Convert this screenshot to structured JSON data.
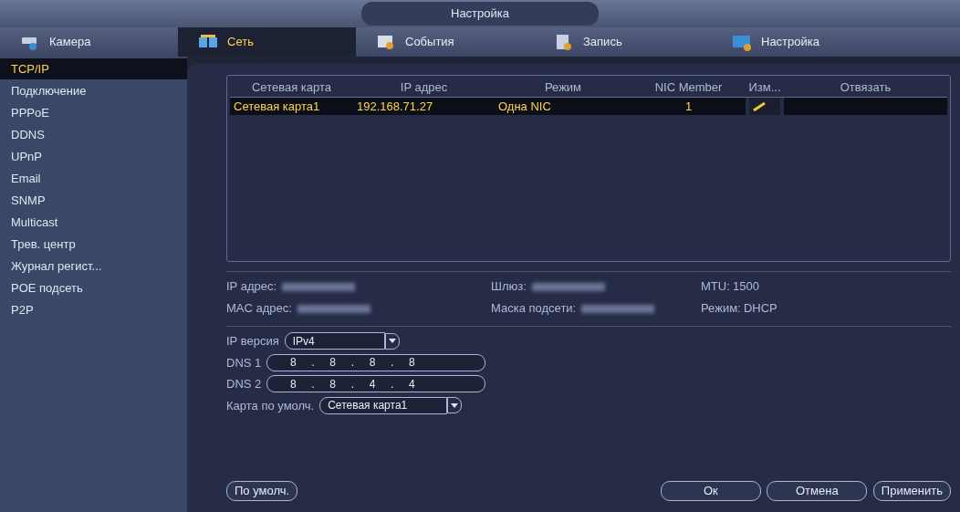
{
  "window": {
    "title": "Настройка"
  },
  "tabs": [
    {
      "label": "Камера",
      "selected": false
    },
    {
      "label": "Сеть",
      "selected": true
    },
    {
      "label": "События",
      "selected": false
    },
    {
      "label": "Запись",
      "selected": false
    },
    {
      "label": "Настройка",
      "selected": false
    }
  ],
  "sidebar": {
    "items": [
      {
        "label": "TCP/IP",
        "selected": true
      },
      {
        "label": "Подключение",
        "selected": false
      },
      {
        "label": "PPPoE",
        "selected": false
      },
      {
        "label": "DDNS",
        "selected": false
      },
      {
        "label": "UPnP",
        "selected": false
      },
      {
        "label": "Email",
        "selected": false
      },
      {
        "label": "SNMP",
        "selected": false
      },
      {
        "label": "Multicast",
        "selected": false
      },
      {
        "label": "Трев. центр",
        "selected": false
      },
      {
        "label": "Журнал регист...",
        "selected": false
      },
      {
        "label": "POE подсеть",
        "selected": false
      },
      {
        "label": "P2P",
        "selected": false
      }
    ]
  },
  "table": {
    "columns": [
      "Сетевая карта",
      "IP адрес",
      "Режим",
      "NIC Member",
      "Изм...",
      "Отвязать"
    ],
    "rows": [
      {
        "selected": true,
        "cells": [
          "Сетевая карта1",
          "192.168.71.27",
          "Одна NIC",
          "1"
        ]
      }
    ]
  },
  "info": {
    "rows": [
      [
        {
          "label": "IP адрес:",
          "kind": "redacted"
        },
        {
          "label": "Шлюз:",
          "kind": "redacted"
        },
        {
          "label": "MTU:",
          "value": "1500",
          "kind": "text"
        }
      ],
      [
        {
          "label": "MAC адрес:",
          "kind": "redacted"
        },
        {
          "label": "Маска подсети:",
          "kind": "redacted"
        },
        {
          "label": "Режим:",
          "value": "DHCP",
          "kind": "text"
        }
      ]
    ]
  },
  "form": {
    "ip_version": {
      "label": "IP версия",
      "value": "IPv4"
    },
    "dns": [
      {
        "label": "DNS 1",
        "octets": [
          "8",
          ".",
          "8",
          ".",
          "8",
          ".",
          "8"
        ]
      },
      {
        "label": "DNS 2",
        "octets": [
          "8",
          ".",
          "8",
          ".",
          "4",
          ".",
          "4"
        ]
      }
    ],
    "default_card": {
      "label": "Карта по умолч.",
      "value": "Сетевая карта1"
    }
  },
  "buttons": {
    "left": [
      "По умолч."
    ],
    "right": [
      "Ок",
      "Отмена",
      "Применить"
    ]
  }
}
